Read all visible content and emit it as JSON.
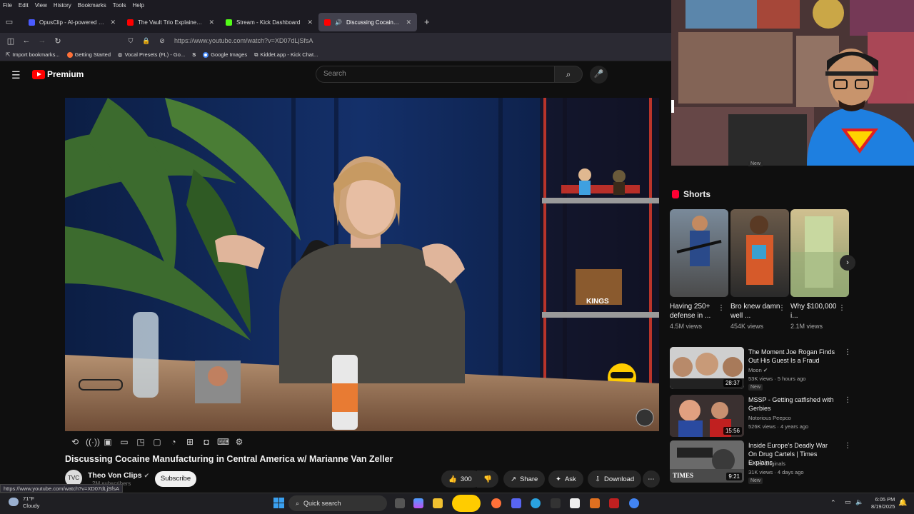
{
  "menubar": [
    "File",
    "Edit",
    "View",
    "History",
    "Bookmarks",
    "Tools",
    "Help"
  ],
  "tabs": [
    {
      "label": "OpusClip - AI-powered Video F",
      "color": "#4a5bff"
    },
    {
      "label": "The Vault Trio Explained | The F",
      "color": "#ff0000"
    },
    {
      "label": "Stream - Kick Dashboard",
      "color": "#53fc18"
    },
    {
      "label": "Discussing Cocaine Manufa",
      "color": "#ff0000",
      "active": true
    }
  ],
  "nav": {
    "url": "https://www.youtube.com/watch?v=XD07dLjSfsA"
  },
  "bookmarks": [
    "Import bookmarks...",
    "Getting Started",
    "Vocal Presets (FL) - Go...",
    "Google Images",
    "Kiddet.app - Kick Chat..."
  ],
  "yt": {
    "brand": "Premium",
    "search_placeholder": "Search"
  },
  "video": {
    "title": "Discussing Cocaine Manufacturing in Central America w/ Marianne Van Zeller",
    "channel": "Theo Von Clips",
    "subscribers": "2M subscribers",
    "subscribe_label": "Subscribe",
    "likes": "300",
    "share_label": "Share",
    "ask_label": "Ask",
    "download_label": "Download",
    "box_text": "KINGS"
  },
  "webcam": {
    "badge": "New"
  },
  "shorts": {
    "heading": "Shorts",
    "items": [
      {
        "title": "Having 250+ defense in ...",
        "views": "4.5M views"
      },
      {
        "title": "Bro knew damn well ...",
        "views": "454K views"
      },
      {
        "title": "Why $100,000 i...",
        "views": "2.1M views"
      }
    ]
  },
  "recs": [
    {
      "title": "The Moment Joe Rogan Finds Out His Guest Is a Fraud",
      "channel": "Moon",
      "meta": "53K views · 5 hours ago",
      "badge": "New",
      "duration": "28:37"
    },
    {
      "title": "MSSP - Getting catfished with Gerbies",
      "channel": "Notorious Peepco",
      "meta": "526K views · 4 years ago",
      "badge": "",
      "duration": "15:56"
    },
    {
      "title": "Inside Europe's Deadly War On Drug Cartels | Times Explains",
      "channel": "Times Originals",
      "meta": "31K views · 4 days ago",
      "badge": "New",
      "duration": "9:21",
      "thumb_label": "TIMES"
    }
  ],
  "status_url": "https://www.youtube.com/watch?v=XD07dLjSfsA",
  "taskbar": {
    "temp": "71°F",
    "weather": "Cloudy",
    "search": "Quick search",
    "time": "6:05 PM",
    "date": "8/19/2025"
  }
}
